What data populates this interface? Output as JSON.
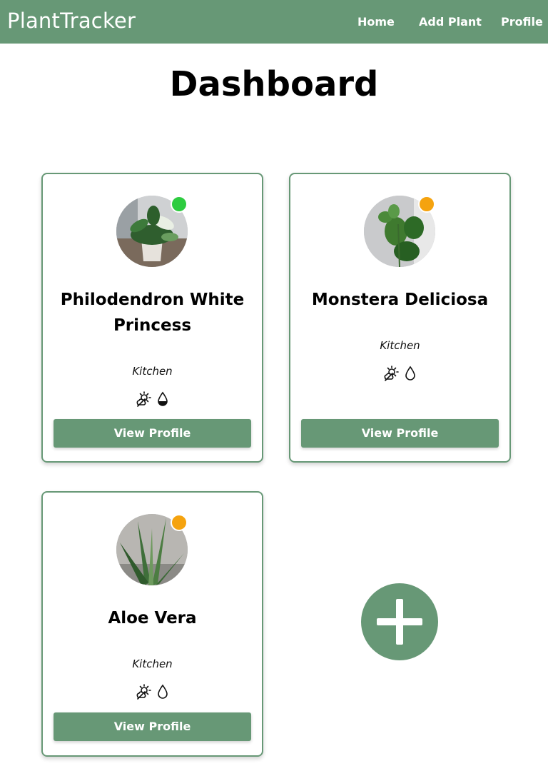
{
  "nav": {
    "brand": "PlantTracker",
    "links": [
      "Home",
      "Add Plant",
      "Profile"
    ],
    "background": "#679876"
  },
  "page": {
    "title": "Dashboard"
  },
  "plants": [
    {
      "name": "Philodendron White Princess",
      "location": "Kitchen",
      "status_color": "#2ecc40",
      "light_icon": "partial-sun-icon",
      "water_icon": "half-drop-icon",
      "button_label": "View Profile"
    },
    {
      "name": "Monstera Deliciosa",
      "location": "Kitchen",
      "status_color": "#f5a30f",
      "light_icon": "partial-sun-icon",
      "water_icon": "drop-outline-icon",
      "button_label": "View Profile"
    },
    {
      "name": "Aloe Vera",
      "location": "Kitchen",
      "status_color": "#f5a30f",
      "light_icon": "partial-sun-icon",
      "water_icon": "drop-outline-icon",
      "button_label": "View Profile"
    }
  ],
  "add_button": {
    "icon": "plus-icon"
  }
}
